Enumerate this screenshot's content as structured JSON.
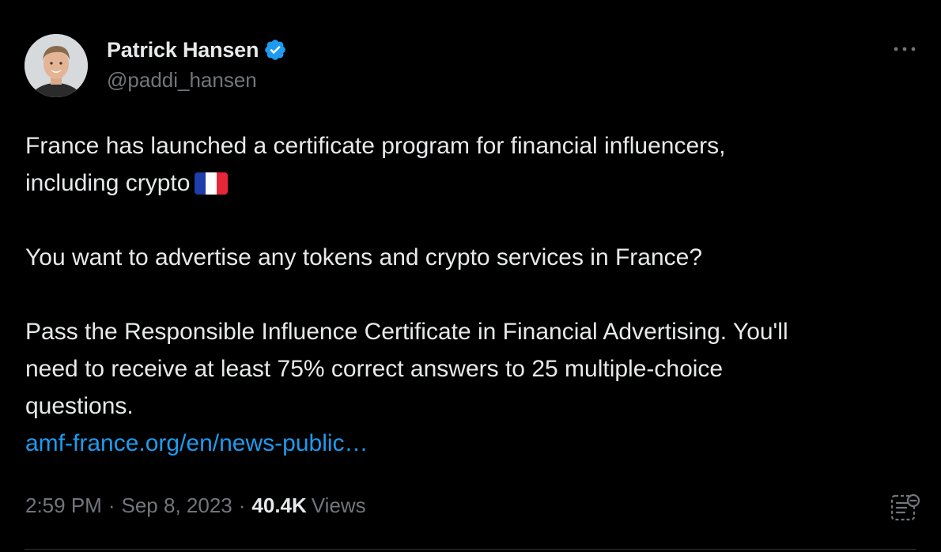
{
  "author": {
    "display_name": "Patrick Hansen",
    "handle": "@paddi_hansen",
    "verified": true,
    "avatar_icon": "avatar-photo"
  },
  "tweet": {
    "lines": {
      "p1_line1": "France has launched a certificate program for financial influencers,",
      "p1_line2": "including crypto",
      "p2": "You want to advertise any tokens and crypto services in France?",
      "p3_line1": "Pass the Responsible Influence Certificate in Financial Advertising. You'll",
      "p3_line2": "need to receive at least 75% correct answers to 25 multiple-choice",
      "p3_line3": "questions."
    },
    "flag_emoji": "France flag",
    "link_text": "amf-france.org/en/news-public…"
  },
  "meta": {
    "time": "2:59 PM",
    "separator": "·",
    "date": "Sep 8, 2023",
    "views_count": "40.4K",
    "views_label": "Views"
  },
  "colors": {
    "background": "#000000",
    "text_primary": "#e7e9ea",
    "text_secondary": "#71767b",
    "link": "#1d9bf0",
    "verified_badge": "#1d9bf0"
  },
  "icons": {
    "more": "more-horizontal-icon",
    "verified": "verified-badge-icon",
    "analytics": "post-analytics-icon"
  }
}
